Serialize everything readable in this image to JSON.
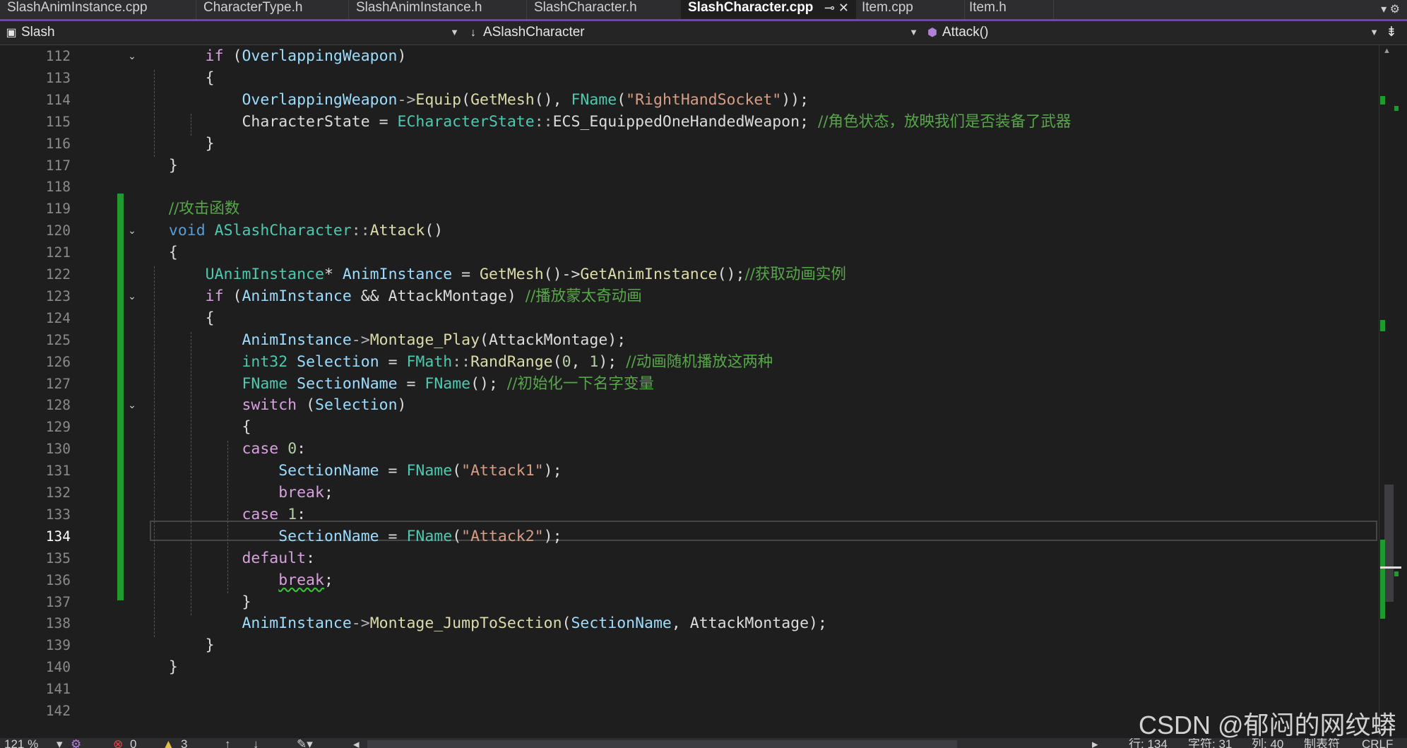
{
  "tabs": [
    {
      "label": "SlashAnimInstance.cpp",
      "active": false
    },
    {
      "label": "CharacterType.h",
      "active": false
    },
    {
      "label": "SlashAnimInstance.h",
      "active": false
    },
    {
      "label": "SlashCharacter.h",
      "active": false
    },
    {
      "label": "SlashCharacter.cpp",
      "active": true
    },
    {
      "label": "Item.cpp",
      "active": false
    },
    {
      "label": "Item.h",
      "active": false
    }
  ],
  "active_tab_icons": "⊸  ✕",
  "tab_overflow": "▾  ⚙",
  "navbar": {
    "project": "Slash",
    "scope": "ASlashCharacter",
    "member": "Attack()",
    "split": "⇟"
  },
  "editor": {
    "current_line": 134,
    "lines": [
      {
        "num": 112,
        "code": [
          [
            "      ",
            "pl"
          ],
          [
            "if",
            "ctl"
          ],
          [
            " (",
            "pl"
          ],
          [
            "OverlappingWeapon",
            "var"
          ],
          [
            ")",
            "pl"
          ]
        ]
      },
      {
        "num": 113,
        "code": [
          [
            "      {",
            "pl"
          ]
        ]
      },
      {
        "num": 114,
        "code": [
          [
            "          ",
            "pl"
          ],
          [
            "OverlappingWeapon",
            "var"
          ],
          [
            "->",
            "op"
          ],
          [
            "Equip",
            "fn"
          ],
          [
            "(",
            "pl"
          ],
          [
            "GetMesh",
            "fn"
          ],
          [
            "(), ",
            "pl"
          ],
          [
            "FName",
            "type"
          ],
          [
            "(",
            "pl"
          ],
          [
            "\"RightHandSocket\"",
            "str"
          ],
          [
            "));",
            "pl"
          ]
        ]
      },
      {
        "num": 115,
        "code": [
          [
            "          ",
            "pl"
          ],
          [
            "CharacterState",
            "pl"
          ],
          [
            " = ",
            "pl"
          ],
          [
            "ECharacterState",
            "type"
          ],
          [
            "::",
            "op"
          ],
          [
            "ECS_EquippedOneHandedWeapon",
            "pl"
          ],
          [
            "; ",
            "pl"
          ],
          [
            "//角色状态，放映我们是否装备了武器",
            "cmt"
          ]
        ]
      },
      {
        "num": 116,
        "code": [
          [
            "      }",
            "pl"
          ]
        ]
      },
      {
        "num": 117,
        "code": [
          [
            "  }",
            "pl"
          ]
        ]
      },
      {
        "num": 118,
        "code": []
      },
      {
        "num": 119,
        "code": [
          [
            "  ",
            "pl"
          ],
          [
            "//攻击函数",
            "cmt"
          ]
        ]
      },
      {
        "num": 120,
        "code": [
          [
            "  ",
            "pl"
          ],
          [
            "void",
            "kw"
          ],
          [
            " ",
            "pl"
          ],
          [
            "ASlashCharacter",
            "type"
          ],
          [
            "::",
            "op"
          ],
          [
            "Attack",
            "fn"
          ],
          [
            "()",
            "pl"
          ]
        ]
      },
      {
        "num": 121,
        "code": [
          [
            "  {",
            "pl"
          ]
        ]
      },
      {
        "num": 122,
        "code": [
          [
            "      ",
            "pl"
          ],
          [
            "UAnimInstance",
            "type"
          ],
          [
            "* ",
            "pl"
          ],
          [
            "AnimInstance",
            "var"
          ],
          [
            " = ",
            "pl"
          ],
          [
            "GetMesh",
            "fn"
          ],
          [
            "()->",
            "pl"
          ],
          [
            "GetAnimInstance",
            "fn"
          ],
          [
            "();",
            "pl"
          ],
          [
            "//获取动画实例",
            "cmt"
          ]
        ]
      },
      {
        "num": 123,
        "code": [
          [
            "      ",
            "pl"
          ],
          [
            "if",
            "ctl"
          ],
          [
            " (",
            "pl"
          ],
          [
            "AnimInstance",
            "var"
          ],
          [
            " && ",
            "pl"
          ],
          [
            "AttackMontage",
            "pl"
          ],
          [
            ") ",
            "pl"
          ],
          [
            "//播放蒙太奇动画",
            "cmt"
          ]
        ]
      },
      {
        "num": 124,
        "code": [
          [
            "      {",
            "pl"
          ]
        ]
      },
      {
        "num": 125,
        "code": [
          [
            "          ",
            "pl"
          ],
          [
            "AnimInstance",
            "var"
          ],
          [
            "->",
            "op"
          ],
          [
            "Montage_Play",
            "fn"
          ],
          [
            "(",
            "pl"
          ],
          [
            "AttackMontage",
            "pl"
          ],
          [
            ");",
            "pl"
          ]
        ]
      },
      {
        "num": 126,
        "code": [
          [
            "          ",
            "pl"
          ],
          [
            "int32",
            "type"
          ],
          [
            " ",
            "pl"
          ],
          [
            "Selection",
            "var"
          ],
          [
            " = ",
            "pl"
          ],
          [
            "FMath",
            "type"
          ],
          [
            "::",
            "op"
          ],
          [
            "RandRange",
            "fn"
          ],
          [
            "(",
            "pl"
          ],
          [
            "0",
            "num"
          ],
          [
            ", ",
            "pl"
          ],
          [
            "1",
            "num"
          ],
          [
            "); ",
            "pl"
          ],
          [
            "//动画随机播放这两种",
            "cmt"
          ]
        ]
      },
      {
        "num": 127,
        "code": [
          [
            "          ",
            "pl"
          ],
          [
            "FName",
            "type"
          ],
          [
            " ",
            "pl"
          ],
          [
            "SectionName",
            "var"
          ],
          [
            " = ",
            "pl"
          ],
          [
            "FName",
            "type"
          ],
          [
            "(); ",
            "pl"
          ],
          [
            "//初始化一下名字变量",
            "cmt"
          ]
        ]
      },
      {
        "num": 128,
        "code": [
          [
            "          ",
            "pl"
          ],
          [
            "switch",
            "ctl"
          ],
          [
            " (",
            "pl"
          ],
          [
            "Selection",
            "var"
          ],
          [
            ")",
            "pl"
          ]
        ]
      },
      {
        "num": 129,
        "code": [
          [
            "          {",
            "pl"
          ]
        ]
      },
      {
        "num": 130,
        "code": [
          [
            "          ",
            "pl"
          ],
          [
            "case",
            "ctl"
          ],
          [
            " ",
            "pl"
          ],
          [
            "0",
            "num"
          ],
          [
            ":",
            "pl"
          ]
        ]
      },
      {
        "num": 131,
        "code": [
          [
            "              ",
            "pl"
          ],
          [
            "SectionName",
            "var"
          ],
          [
            " = ",
            "pl"
          ],
          [
            "FName",
            "type"
          ],
          [
            "(",
            "pl"
          ],
          [
            "\"Attack1\"",
            "str"
          ],
          [
            ");",
            "pl"
          ]
        ]
      },
      {
        "num": 132,
        "code": [
          [
            "              ",
            "pl"
          ],
          [
            "break",
            "ctl"
          ],
          [
            ";",
            "pl"
          ]
        ]
      },
      {
        "num": 133,
        "code": [
          [
            "          ",
            "pl"
          ],
          [
            "case",
            "ctl"
          ],
          [
            " ",
            "pl"
          ],
          [
            "1",
            "num"
          ],
          [
            ":",
            "pl"
          ]
        ]
      },
      {
        "num": 134,
        "code": [
          [
            "              ",
            "pl"
          ],
          [
            "SectionName",
            "var"
          ],
          [
            " = ",
            "pl"
          ],
          [
            "FName",
            "type"
          ],
          [
            "(",
            "pl"
          ],
          [
            "\"Attack2\"",
            "str"
          ],
          [
            ");",
            "pl"
          ]
        ]
      },
      {
        "num": 135,
        "code": [
          [
            "          ",
            "pl"
          ],
          [
            "default",
            "ctl"
          ],
          [
            ":",
            "pl"
          ]
        ]
      },
      {
        "num": 136,
        "code": [
          [
            "              ",
            "pl"
          ],
          [
            "break",
            "ctl sq"
          ],
          [
            ";",
            "pl"
          ]
        ]
      },
      {
        "num": 137,
        "code": [
          [
            "          }",
            "pl"
          ]
        ]
      },
      {
        "num": 138,
        "code": [
          [
            "          ",
            "pl"
          ],
          [
            "AnimInstance",
            "var"
          ],
          [
            "->",
            "op"
          ],
          [
            "Montage_JumpToSection",
            "fn"
          ],
          [
            "(",
            "pl"
          ],
          [
            "SectionName",
            "var"
          ],
          [
            ", ",
            "pl"
          ],
          [
            "AttackMontage",
            "pl"
          ],
          [
            ");",
            "pl"
          ]
        ]
      },
      {
        "num": 139,
        "code": [
          [
            "      }",
            "pl"
          ]
        ]
      },
      {
        "num": 140,
        "code": [
          [
            "  }",
            "pl"
          ]
        ]
      },
      {
        "num": 141,
        "code": []
      },
      {
        "num": 142,
        "code": []
      }
    ]
  },
  "statusbar": {
    "zoom": "121 %",
    "errors": "0",
    "warnings": "3",
    "line": "行: 134",
    "char": "字符: 31",
    "col": "列: 40",
    "tabs": "制表符",
    "eol": "CRLF"
  },
  "watermark": "CSDN @郁闷的网纹蟒",
  "colors": {
    "accent": "#6f42c1",
    "change_bar": "#1e9a2e",
    "keyword": "#569cd6",
    "control": "#d8a0df",
    "type": "#4ec9b0",
    "function": "#dcdcaa",
    "variable": "#9cdcfe",
    "string": "#d69d85",
    "comment": "#57a64a"
  }
}
